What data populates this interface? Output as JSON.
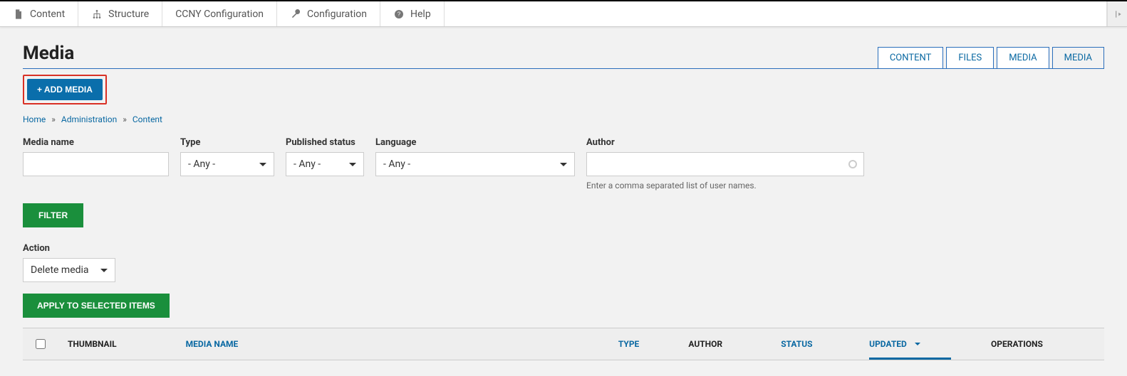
{
  "topnav": {
    "items": [
      {
        "label": "Content",
        "icon": "file"
      },
      {
        "label": "Structure",
        "icon": "hierarchy"
      },
      {
        "label": "CCNY Configuration",
        "icon": ""
      },
      {
        "label": "Configuration",
        "icon": "wrench"
      },
      {
        "label": "Help",
        "icon": "question"
      }
    ]
  },
  "page": {
    "title": "Media",
    "tabs": [
      "CONTENT",
      "FILES",
      "MEDIA",
      "MEDIA"
    ],
    "active_tab_index": 3,
    "add_button": "+ ADD MEDIA"
  },
  "breadcrumb": [
    "Home",
    "Administration",
    "Content"
  ],
  "filters": {
    "media_name": {
      "label": "Media name",
      "value": ""
    },
    "type": {
      "label": "Type",
      "value": "- Any -"
    },
    "published": {
      "label": "Published status",
      "value": "- Any -"
    },
    "language": {
      "label": "Language",
      "value": "- Any -"
    },
    "author": {
      "label": "Author",
      "value": "",
      "hint": "Enter a comma separated list of user names."
    },
    "filter_button": "FILTER"
  },
  "bulk": {
    "action_label": "Action",
    "action_value": "Delete media",
    "apply_button": "APPLY TO SELECTED ITEMS"
  },
  "table": {
    "columns": {
      "thumbnail": "THUMBNAIL",
      "media_name": "MEDIA NAME",
      "type": "TYPE",
      "author": "AUTHOR",
      "status": "STATUS",
      "updated": "UPDATED",
      "operations": "OPERATIONS"
    }
  }
}
